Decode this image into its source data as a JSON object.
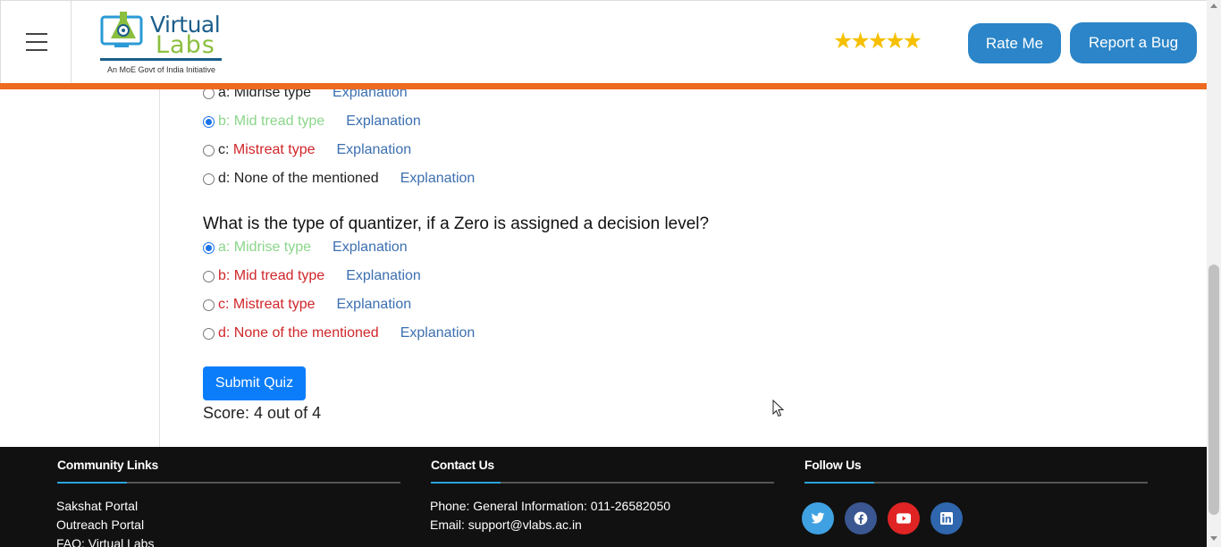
{
  "header": {
    "logo_word1": "Virtual",
    "logo_word2": "Labs",
    "logo_tagline": "An MoE Govt of India Initiative",
    "rating_stars": "★★★★★",
    "rate_label": "Rate Me",
    "bug_label": "Report a Bug"
  },
  "quiz": {
    "prev_options": [
      {
        "letter": "a:",
        "text": "Midrise type",
        "explanation": "Explanation"
      },
      {
        "letter": "b:",
        "text": "Mid tread type",
        "explanation": "Explanation"
      },
      {
        "letter": "c:",
        "text": "Mistreat type",
        "explanation": "Explanation"
      },
      {
        "letter": "d:",
        "text": "None of the mentioned",
        "explanation": "Explanation"
      }
    ],
    "question": "What is the type of quantizer, if a Zero is assigned a decision level?",
    "options": [
      {
        "letter": "a:",
        "text": "Midrise type",
        "explanation": "Explanation"
      },
      {
        "letter": "b:",
        "text": "Mid tread type",
        "explanation": "Explanation"
      },
      {
        "letter": "c:",
        "text": "Mistreat type",
        "explanation": "Explanation"
      },
      {
        "letter": "d:",
        "text": "None of the mentioned",
        "explanation": "Explanation"
      }
    ],
    "submit_label": "Submit Quiz",
    "score": "Score: 4 out of 4"
  },
  "footer": {
    "community": {
      "heading": "Community Links",
      "links": [
        "Sakshat Portal",
        "Outreach Portal",
        "FAQ: Virtual Labs"
      ]
    },
    "contact": {
      "heading": "Contact Us",
      "phone": "Phone: General Information: 011-26582050",
      "email": "Email: support@vlabs.ac.in"
    },
    "follow": {
      "heading": "Follow Us",
      "icons": [
        "twitter-icon",
        "facebook-icon",
        "youtube-icon",
        "linkedin-icon"
      ]
    }
  },
  "colors": {
    "accent_orange": "#ee6a1e",
    "button_blue": "#2b85c8",
    "submit_blue": "#0b7dfa",
    "correct_green": "#8bd68b",
    "wrong_red": "#d0262a",
    "link_blue": "#3c6fb0"
  }
}
